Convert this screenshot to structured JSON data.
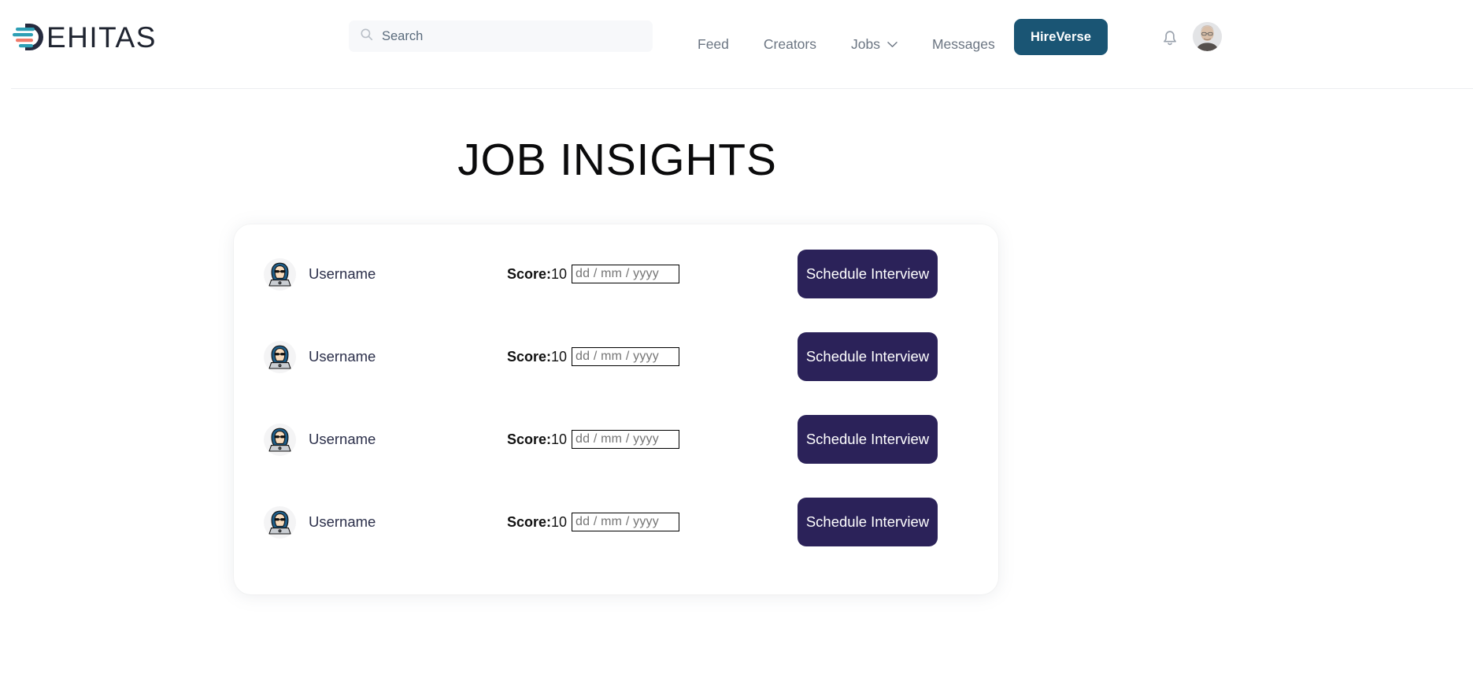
{
  "header": {
    "logo": {
      "word": "EHITAS",
      "mark_name": "dehitas-logo-mark",
      "mark_dark": "#262b3f",
      "mark_teal": "#2e9fb5",
      "mark_coral": "#f07a6a"
    },
    "search": {
      "placeholder": "Search",
      "value": "",
      "icon": "search-icon"
    },
    "nav": [
      {
        "label": "Feed",
        "icon": null
      },
      {
        "label": "Creators",
        "icon": null
      },
      {
        "label": "Jobs",
        "icon": "chevron-down-icon"
      },
      {
        "label": "Messages",
        "icon": null
      }
    ],
    "cta": {
      "label": "HireVerse",
      "bg": "#1a5574",
      "fg": "#ffffff"
    },
    "notification_icon": "bell-icon",
    "avatar": "user-avatar-photo"
  },
  "main": {
    "title": "JOB INSIGHTS",
    "rows": [
      {
        "avatar_icon": "hacker-avatar-icon",
        "username": "Username",
        "score_label": "Score:",
        "score_value": "10",
        "date_placeholder": "dd / mm / yyyy",
        "date_value": "",
        "action_label": "Schedule Interview"
      },
      {
        "avatar_icon": "hacker-avatar-icon",
        "username": "Username",
        "score_label": "Score:",
        "score_value": "10",
        "date_placeholder": "dd / mm / yyyy",
        "date_value": "",
        "action_label": "Schedule Interview"
      },
      {
        "avatar_icon": "hacker-avatar-icon",
        "username": "Username",
        "score_label": "Score:",
        "score_value": "10",
        "date_placeholder": "dd / mm / yyyy",
        "date_value": "",
        "action_label": "Schedule Interview"
      },
      {
        "avatar_icon": "hacker-avatar-icon",
        "username": "Username",
        "score_label": "Score:",
        "score_value": "10",
        "date_placeholder": "dd / mm / yyyy",
        "date_value": "",
        "action_label": "Schedule Interview"
      }
    ]
  },
  "theme": {
    "accent_dark_navy": "#2b2259",
    "accent_teal_blue": "#1a5574",
    "page_bg": "#ffffff",
    "card_bg": "#ffffff",
    "muted_text": "#6b7582"
  }
}
